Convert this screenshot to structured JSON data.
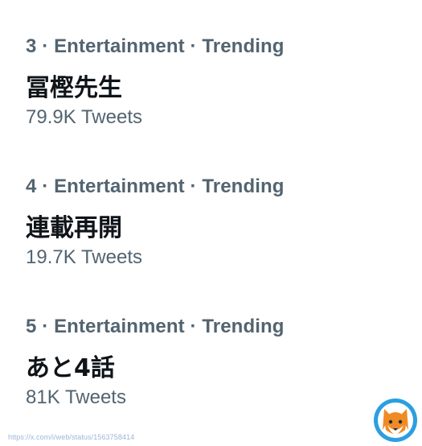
{
  "trends": [
    {
      "meta": "3 · Entertainment · Trending",
      "name": "冨樫先生",
      "tweets": "79.9K Tweets"
    },
    {
      "meta": "4 · Entertainment · Trending",
      "name": "連載再開",
      "tweets": "19.7K Tweets"
    },
    {
      "meta": "5 · Entertainment · Trending",
      "name": "あと4話",
      "tweets": "81K Tweets"
    }
  ],
  "watermark": {
    "url": "https://x.com/i/web/status/1563758414"
  },
  "colors": {
    "meta_text": "#536471",
    "primary_text": "#0f1419",
    "logo_blue": "#2b9fe0",
    "logo_orange": "#f08a24"
  },
  "icons": {
    "logo": "fox-logo"
  }
}
